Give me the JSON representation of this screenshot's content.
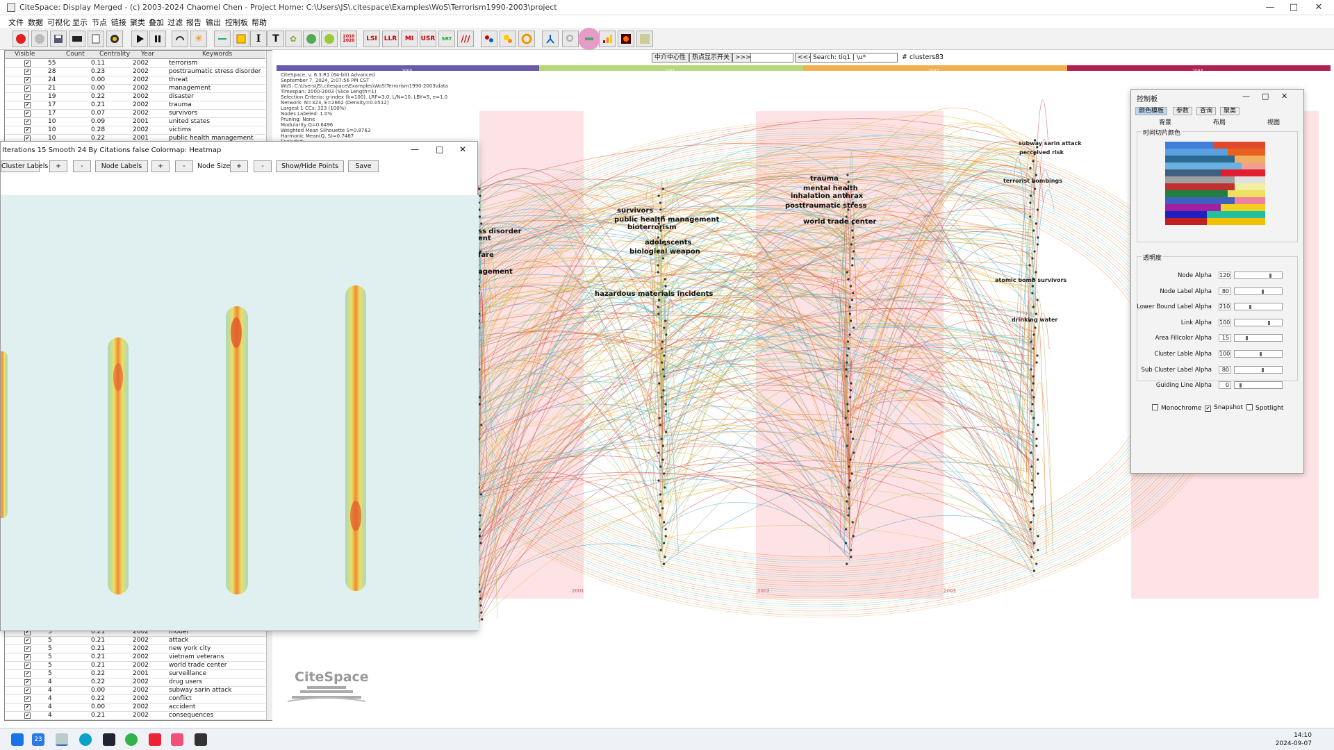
{
  "window": {
    "title": "CiteSpace: Display Merged - (c) 2003-2024 Chaomei Chen - Project Home: C:\\Users\\JS\\.citespace\\Examples\\WoS\\Terrorism1990-2003\\project",
    "minimize": "—",
    "maximize": "□",
    "close": "✕"
  },
  "menu": [
    "文件",
    "数据",
    "可视化",
    "显示",
    "节点",
    "链接",
    "聚类",
    "叠加",
    "过滤",
    "报告",
    "输出",
    "控制板",
    "帮助"
  ],
  "toolbar_icons": [
    "record-icon",
    "stop-icon",
    "save-icon",
    "film-icon",
    "export-icon",
    "gear-icon",
    "play-icon",
    "pause-icon",
    "rotate-icon",
    "burst-icon",
    "line-icon",
    "grid-icon",
    "bold-icon",
    "text-icon",
    "tree-icon",
    "sc-icon",
    "circle-icon",
    "year-icon",
    "lsi-icon",
    "llr-icon",
    "mi-icon",
    "usr-icon",
    "sort-icon",
    "parallel-icon",
    "network-icon",
    "cluster-icon",
    "ring-icon",
    "hierarchy-icon",
    "magnify-icon",
    "timeline-icon",
    "burst-chart-icon",
    "heat-icon",
    "map-icon"
  ],
  "toolbar_text": {
    "lsi": "LSI",
    "llr": "LLR",
    "mi": "MI",
    "usr": "USR",
    "year": "2010 2020"
  },
  "table": {
    "headers": [
      "Visible",
      "Count",
      "Centrality",
      "Year",
      "Keywords"
    ],
    "rows_top": [
      [
        "✔",
        "55",
        "0.11",
        "2002",
        "terrorism"
      ],
      [
        "✔",
        "28",
        "0.23",
        "2002",
        "posttraumatic stress disorder"
      ],
      [
        "✔",
        "24",
        "0.00",
        "2002",
        "threat"
      ],
      [
        "✔",
        "21",
        "0.00",
        "2002",
        "management"
      ],
      [
        "✔",
        "19",
        "0.22",
        "2002",
        "disaster"
      ],
      [
        "✔",
        "17",
        "0.21",
        "2002",
        "trauma"
      ],
      [
        "✔",
        "17",
        "0.07",
        "2002",
        "survivors"
      ],
      [
        "✔",
        "10",
        "0.09",
        "2001",
        "united states"
      ],
      [
        "✔",
        "10",
        "0.28",
        "2002",
        "victims"
      ],
      [
        "✔",
        "10",
        "0.22",
        "2001",
        "public health management"
      ]
    ],
    "rows_bottom": [
      [
        "✔",
        "5",
        "0.21",
        "2002",
        "model"
      ],
      [
        "✔",
        "5",
        "0.21",
        "2002",
        "attack"
      ],
      [
        "✔",
        "5",
        "0.21",
        "2002",
        "new york city"
      ],
      [
        "✔",
        "5",
        "0.21",
        "2002",
        "vietnam veterans"
      ],
      [
        "✔",
        "5",
        "0.21",
        "2002",
        "world trade center"
      ],
      [
        "✔",
        "5",
        "0.22",
        "2001",
        "surveillance"
      ],
      [
        "✔",
        "4",
        "0.22",
        "2002",
        "drug users"
      ],
      [
        "✔",
        "4",
        "0.00",
        "2002",
        "subway sarin attack"
      ],
      [
        "✔",
        "4",
        "0.22",
        "2002",
        "conflict"
      ],
      [
        "✔",
        "4",
        "0.00",
        "2002",
        "accident"
      ],
      [
        "✔",
        "4",
        "0.21",
        "2002",
        "consequences"
      ]
    ]
  },
  "view_header": {
    "btn1": "中介中心性",
    "btn2": "热点显示开关",
    "btn3": ">>>",
    "btn4": "<<<",
    "search_value": "Search: tiq1 | \\u*",
    "clusters_label": "# clusters",
    "clusters_value": "83"
  },
  "timeline": {
    "labels": [
      "2000",
      "2001",
      "2002",
      "2003"
    ],
    "colors": [
      "#6a5aa8",
      "#b7d77a",
      "#f0b050",
      "#b02050"
    ]
  },
  "info_lines": [
    "CiteSpace, v. 6.3.R1 (64-bit) Advanced",
    "September 7, 2024, 2:07:56 PM CST",
    "WoS: C:\\Users\\JS\\.citespace\\Examples\\WoS\\Terrorism1990-2003\\data",
    "Timespan: 2000-2003 (Slice Length=1)",
    "Selection Criteria: g-index (k=100), LRF=3.0, L/N=10, LBY=5, e=1.0",
    "Network: N=323, E=2662 (Density=0.0512)",
    "Largest 1 CCs: 323 (100%)",
    "Nodes Labeled: 1.0%",
    "Pruning: None",
    "Modularity Q=0.6496",
    "Weighted Mean Silhouette S=0.8763",
    "Harmonic Mean(Q, S)=0.7467",
    "Excluded:"
  ],
  "year_marks": [
    "2001",
    "2002",
    "2003"
  ],
  "node_labels": [
    {
      "text": "ss disorder",
      "col": "a"
    },
    {
      "text": "ent",
      "col": "a"
    },
    {
      "text": "fare",
      "col": "a"
    },
    {
      "text": "agement",
      "col": "a"
    },
    {
      "text": "survivors",
      "col": "b"
    },
    {
      "text": "public health management",
      "col": "b"
    },
    {
      "text": "bioterrorism",
      "col": "b"
    },
    {
      "text": "adolescents",
      "col": "b"
    },
    {
      "text": "biological weapon",
      "col": "b"
    },
    {
      "text": "hazardous materials incidents",
      "col": "b"
    },
    {
      "text": "trauma",
      "col": "c"
    },
    {
      "text": "mental health",
      "col": "c"
    },
    {
      "text": "inhalation anthrax",
      "col": "c"
    },
    {
      "text": "posttraumatic stress",
      "col": "c"
    },
    {
      "text": "world trade center",
      "col": "c"
    },
    {
      "text": "subway sarin attack",
      "col": "d"
    },
    {
      "text": "perceived risk",
      "col": "d"
    },
    {
      "text": "terrorist bombings",
      "col": "d"
    },
    {
      "text": "atomic bomb survivors",
      "col": "d"
    },
    {
      "text": "drinking water",
      "col": "d"
    }
  ],
  "heatmap_window": {
    "title": "Iterations 15 Smooth 24 By Citations false Colormap: Heatmap",
    "buttons": [
      "Cluster Labels",
      "+",
      "-",
      "Node Labels",
      "+",
      "-",
      "Node Size",
      "+",
      "-",
      "Show/Hide Points",
      "Save"
    ],
    "minimize": "—",
    "maximize": "□",
    "close": "✕"
  },
  "control_panel": {
    "title": "控制板",
    "tabs": [
      "颜色模板",
      "参数",
      "查询",
      "聚类"
    ],
    "subtabs": [
      "背景",
      "布局",
      "视图"
    ],
    "colormap_group": "时间切片颜色",
    "alpha_group": "透明度",
    "sliders": [
      {
        "label": "Node Alpha",
        "value": "120",
        "pos": 0.8
      },
      {
        "label": "Node Label Alpha",
        "value": "80",
        "pos": 0.6
      },
      {
        "label": "Lower Bound Label Alpha",
        "value": "210",
        "pos": 0.3
      },
      {
        "label": "Link Alpha",
        "value": "100",
        "pos": 0.75
      },
      {
        "label": "Area Fillcolor Alpha",
        "value": "15",
        "pos": 0.2
      },
      {
        "label": "Cluster Lable Alpha",
        "value": "100",
        "pos": 0.55
      },
      {
        "label": "Sub Cluster Label Alpha",
        "value": "80",
        "pos": 0.6
      },
      {
        "label": "Guiding Line Alpha",
        "value": "0",
        "pos": 0.05
      }
    ],
    "checks": [
      {
        "label": "Monochrome",
        "checked": false
      },
      {
        "label": "Snapshot",
        "checked": true
      },
      {
        "label": "Spotlight",
        "checked": false
      }
    ],
    "minimize": "—",
    "maximize": "□",
    "close": "✕"
  },
  "logo": "CiteSpace",
  "taskbar": {
    "time": "14:10",
    "date": "2024-09-07",
    "weather_badge": "23"
  }
}
